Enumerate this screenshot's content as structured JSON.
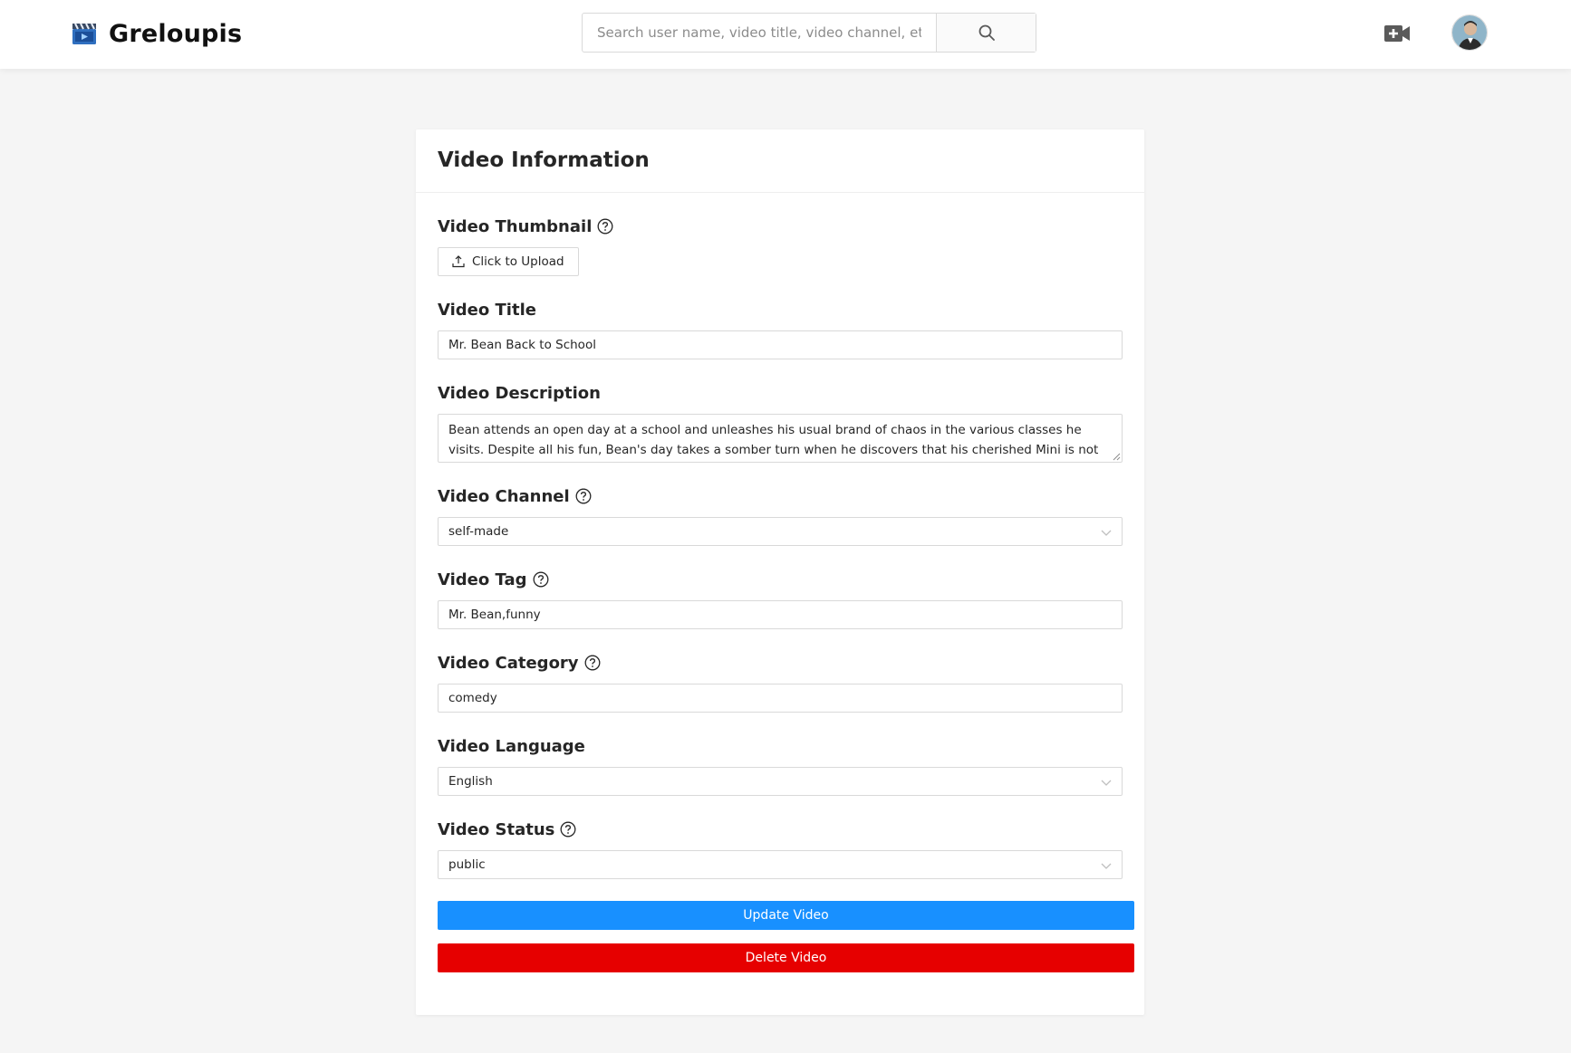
{
  "header": {
    "brand": "Greloupis",
    "search": {
      "placeholder": "Search user name, video title, video channel, etc.",
      "value": ""
    },
    "icons": {
      "logo": "clapperboard-icon",
      "search": "search-icon",
      "upload": "video-camera-plus-icon",
      "avatar": "user-avatar"
    }
  },
  "card": {
    "title": "Video Information",
    "fields": {
      "thumbnail": {
        "label": "Video Thumbnail",
        "button": "Click to Upload"
      },
      "title": {
        "label": "Video Title",
        "value": "Mr. Bean Back to School"
      },
      "description": {
        "label": "Video Description",
        "value": "Bean attends an open day at a school and unleashes his usual brand of chaos in the various classes he visits. Despite all his fun, Bean's day takes a somber turn when he discovers that his cherished Mini is not where he left it."
      },
      "channel": {
        "label": "Video Channel",
        "value": "self-made"
      },
      "tag": {
        "label": "Video Tag",
        "value": "Mr. Bean,funny"
      },
      "category": {
        "label": "Video Category",
        "value": "comedy"
      },
      "language": {
        "label": "Video Language",
        "value": "English"
      },
      "status": {
        "label": "Video Status",
        "value": "public"
      }
    },
    "buttons": {
      "update": "Update Video",
      "delete": "Delete Video"
    }
  },
  "colors": {
    "primary": "#1890ff",
    "danger": "#e60000",
    "background": "#f5f5f5"
  }
}
